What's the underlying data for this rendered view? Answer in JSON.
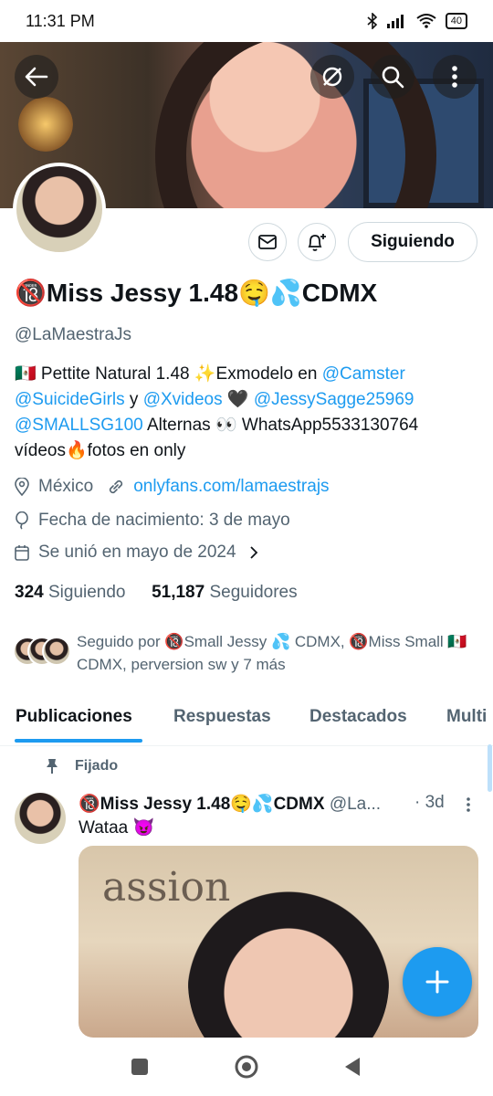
{
  "status_bar": {
    "time": "11:31 PM",
    "battery": "40"
  },
  "header": {
    "back_icon": "arrow-left-icon",
    "actions": [
      "no-sync-icon",
      "search-icon",
      "more-vertical-icon"
    ]
  },
  "profile": {
    "name": "🔞Miss Jessy 1.48🤤💦CDMX",
    "handle": "@LaMaestraJs",
    "follow_button": "Siguiendo",
    "bio": {
      "line1_prefix": "🇲🇽 Pettite Natural 1.48 ✨Exmodelo en ",
      "mention1": "@Camster",
      "mention2": "@SuicideGirls",
      "y": " y ",
      "mention3": "@Xvideos",
      "heart": " 🖤 ",
      "mention4": "@JessySagge25969",
      "mention5": "@SMALLSG100",
      "line3_suffix": " Alternas 👀 WhatsApp5533130764",
      "line4": "vídeos🔥fotos en only"
    },
    "location": "México",
    "website": "onlyfans.com/lamaestrajs",
    "birthday": "Fecha de nacimiento: 3 de mayo",
    "joined": "Se unió en mayo de 2024",
    "following_count": "324",
    "following_label": "Siguiendo",
    "followers_count": "51,187",
    "followers_label": "Seguidores",
    "followed_by": "Seguido por 🔞Small Jessy 💦 CDMX, 🔞Miss Small 🇲🇽 CDMX, perversion sw y 7 más"
  },
  "tabs": [
    "Publicaciones",
    "Respuestas",
    "Destacados",
    "Multi"
  ],
  "post": {
    "pinned_label": "Fijado",
    "author": "🔞Miss Jessy 1.48🤤💦CDMX",
    "handle": "@La...",
    "time": "· 3d",
    "text": "Wataa 😈",
    "media_text": "assion"
  },
  "colors": {
    "accent": "#1d9bf0",
    "text": "#0f1419",
    "muted": "#536471"
  }
}
